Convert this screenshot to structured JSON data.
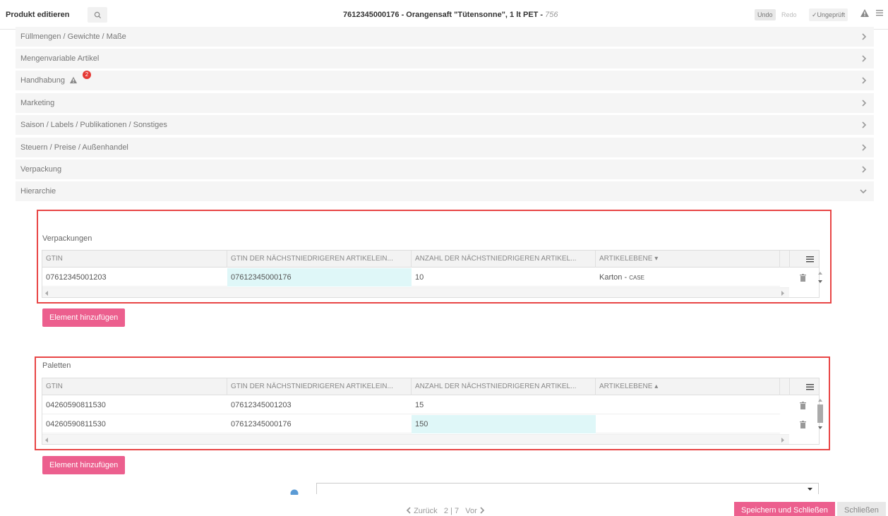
{
  "header": {
    "title": "Produkt editieren",
    "product": "7612345000176 - Orangensaft \"Tütensonne\", 1 lt PET - ",
    "product_num": "756",
    "undo": "Undo",
    "redo": "Redo",
    "unchecked": "Ungeprüft"
  },
  "sections": [
    {
      "label": "Füllmengen / Gewichte / Maße"
    },
    {
      "label": "Mengenvariable Artikel"
    },
    {
      "label": "Handhabung",
      "badge": "2"
    },
    {
      "label": "Marketing"
    },
    {
      "label": "Saison / Labels / Publikationen / Sonstiges"
    },
    {
      "label": "Steuern / Preise / Außenhandel"
    },
    {
      "label": "Verpackung"
    },
    {
      "label": "Hierarchie"
    }
  ],
  "verpackungen": {
    "title": "Verpackungen",
    "columns": [
      "GTIN",
      "GTIN DER NÄCHSTNIEDRIGEREN ARTIKELEIN...",
      "ANZAHL DER NÄCHSTNIEDRIGEREN ARTIKEL...",
      "ARTIKELEBENE"
    ],
    "rows": [
      {
        "gtin": "07612345001203",
        "lower_gtin": "07612345000176",
        "count": "10",
        "level": "Karton - ",
        "level_code": "CASE"
      }
    ],
    "add_label": "Element hinzufügen"
  },
  "paletten": {
    "title": "Paletten",
    "columns": [
      "GTIN",
      "GTIN DER NÄCHSTNIEDRIGEREN ARTIKELEIN...",
      "ANZAHL DER NÄCHSTNIEDRIGEREN ARTIKEL...",
      "ARTIKELEBENE"
    ],
    "rows": [
      {
        "gtin": "04260590811530",
        "lower_gtin": "07612345001203",
        "count": "15",
        "level": ""
      },
      {
        "gtin": "04260590811530",
        "lower_gtin": "07612345000176",
        "count": "150",
        "level": ""
      }
    ],
    "add_label": "Element hinzufügen"
  },
  "footer": {
    "prev": "Zurück",
    "page": "2 | 7",
    "next": "Vor",
    "save": "Speichern und Schließen",
    "close": "Schließen"
  },
  "colors": {
    "accent": "#ec5f8e",
    "highlight": "#dff7f8",
    "annotation": "#e84545"
  }
}
